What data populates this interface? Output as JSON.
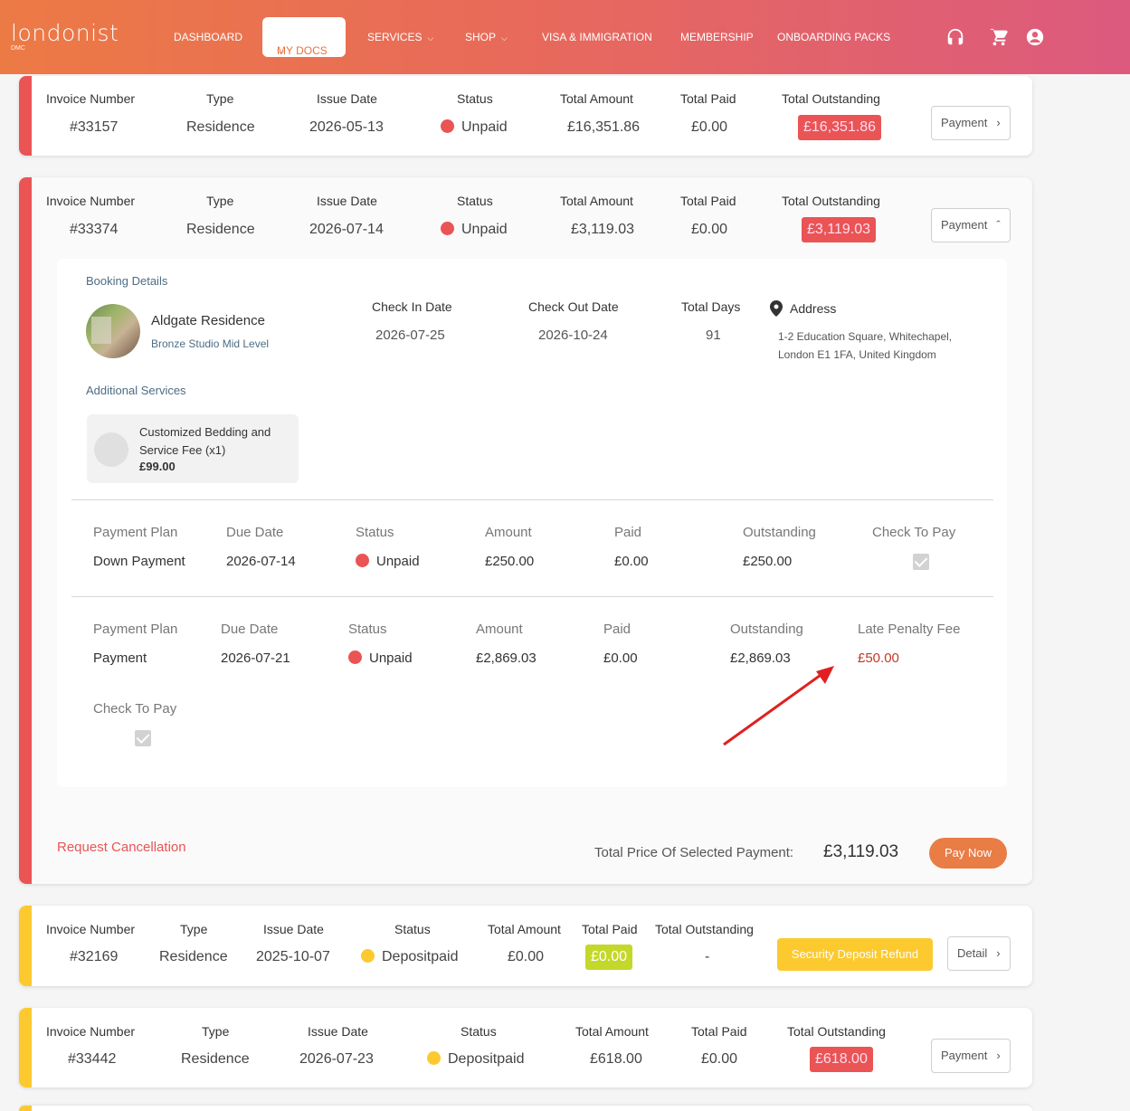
{
  "header": {
    "logo": "londonist",
    "logo_sub": "DMC",
    "nav": {
      "dashboard": "DASHBOARD",
      "my_docs": "MY DOCS",
      "services": "SERVICES",
      "shop": "SHOP",
      "visa": "VISA & IMMIGRATION",
      "membership": "MEMBERSHIP",
      "onboarding": "ONBOARDING PACKS"
    },
    "icons": [
      "headset-icon",
      "cart-icon",
      "account-icon"
    ]
  },
  "labels": {
    "invoice_number": "Invoice Number",
    "type": "Type",
    "issue_date": "Issue Date",
    "status": "Status",
    "total_amount": "Total Amount",
    "total_paid": "Total Paid",
    "total_outstanding": "Total Outstanding",
    "payment": "Payment",
    "detail": "Detail"
  },
  "invoices": [
    {
      "number": "#33157",
      "type": "Residence",
      "issue_date": "2026-05-13",
      "status": "Unpaid",
      "total_amount": "£16,351.86",
      "total_paid": "£0.00",
      "total_outstanding": "£16,351.86"
    },
    {
      "number": "#33374",
      "type": "Residence",
      "issue_date": "2026-07-14",
      "status": "Unpaid",
      "total_amount": "£3,119.03",
      "total_paid": "£0.00",
      "total_outstanding": "£3,119.03"
    },
    {
      "number": "#32169",
      "type": "Residence",
      "issue_date": "2025-10-07",
      "status": "Depositpaid",
      "total_amount": "£0.00",
      "total_paid": "£0.00",
      "total_outstanding": "-",
      "refund_label": "Security Deposit Refund"
    },
    {
      "number": "#33442",
      "type": "Residence",
      "issue_date": "2026-07-23",
      "status": "Depositpaid",
      "total_amount": "£618.00",
      "total_paid": "£0.00",
      "total_outstanding": "£618.00"
    }
  ],
  "booking": {
    "section_title": "Booking Details",
    "name": "Aldgate Residence",
    "room": "Bronze Studio Mid Level",
    "check_in_label": "Check In Date",
    "check_in": "2026-07-25",
    "check_out_label": "Check Out Date",
    "check_out": "2026-10-24",
    "total_days_label": "Total Days",
    "total_days": "91",
    "address_label": "Address",
    "address_line1": "1-2 Education Square, Whitechapel,",
    "address_line2": "London E1 1FA, United Kingdom"
  },
  "additional": {
    "section_title": "Additional Services",
    "service_line1": "Customized Bedding and",
    "service_line2": "Service Fee (x1)",
    "service_price": "£99.00"
  },
  "plan_labels": {
    "payment_plan": "Payment Plan",
    "due_date": "Due Date",
    "status": "Status",
    "amount": "Amount",
    "paid": "Paid",
    "outstanding": "Outstanding",
    "check_to_pay": "Check To Pay",
    "late_penalty": "Late Penalty Fee"
  },
  "plans": [
    {
      "plan": "Down Payment",
      "due": "2026-07-14",
      "status": "Unpaid",
      "amount": "£250.00",
      "paid": "£0.00",
      "outstanding": "£250.00",
      "checked": true
    },
    {
      "plan": "Payment",
      "due": "2026-07-21",
      "status": "Unpaid",
      "amount": "£2,869.03",
      "paid": "£0.00",
      "outstanding": "£2,869.03",
      "late_fee": "£50.00",
      "checked": true
    }
  ],
  "footer": {
    "request_cancellation": "Request Cancellation",
    "total_label": "Total Price Of Selected Payment:",
    "total_value": "£3,119.03",
    "pay_now": "Pay Now"
  },
  "colors": {
    "accent": "#ea7c46",
    "unpaid": "#ea5455",
    "deposit": "#fcc92f",
    "paid_badge": "#c3d82b",
    "annotation_arrow": "#e02020"
  }
}
